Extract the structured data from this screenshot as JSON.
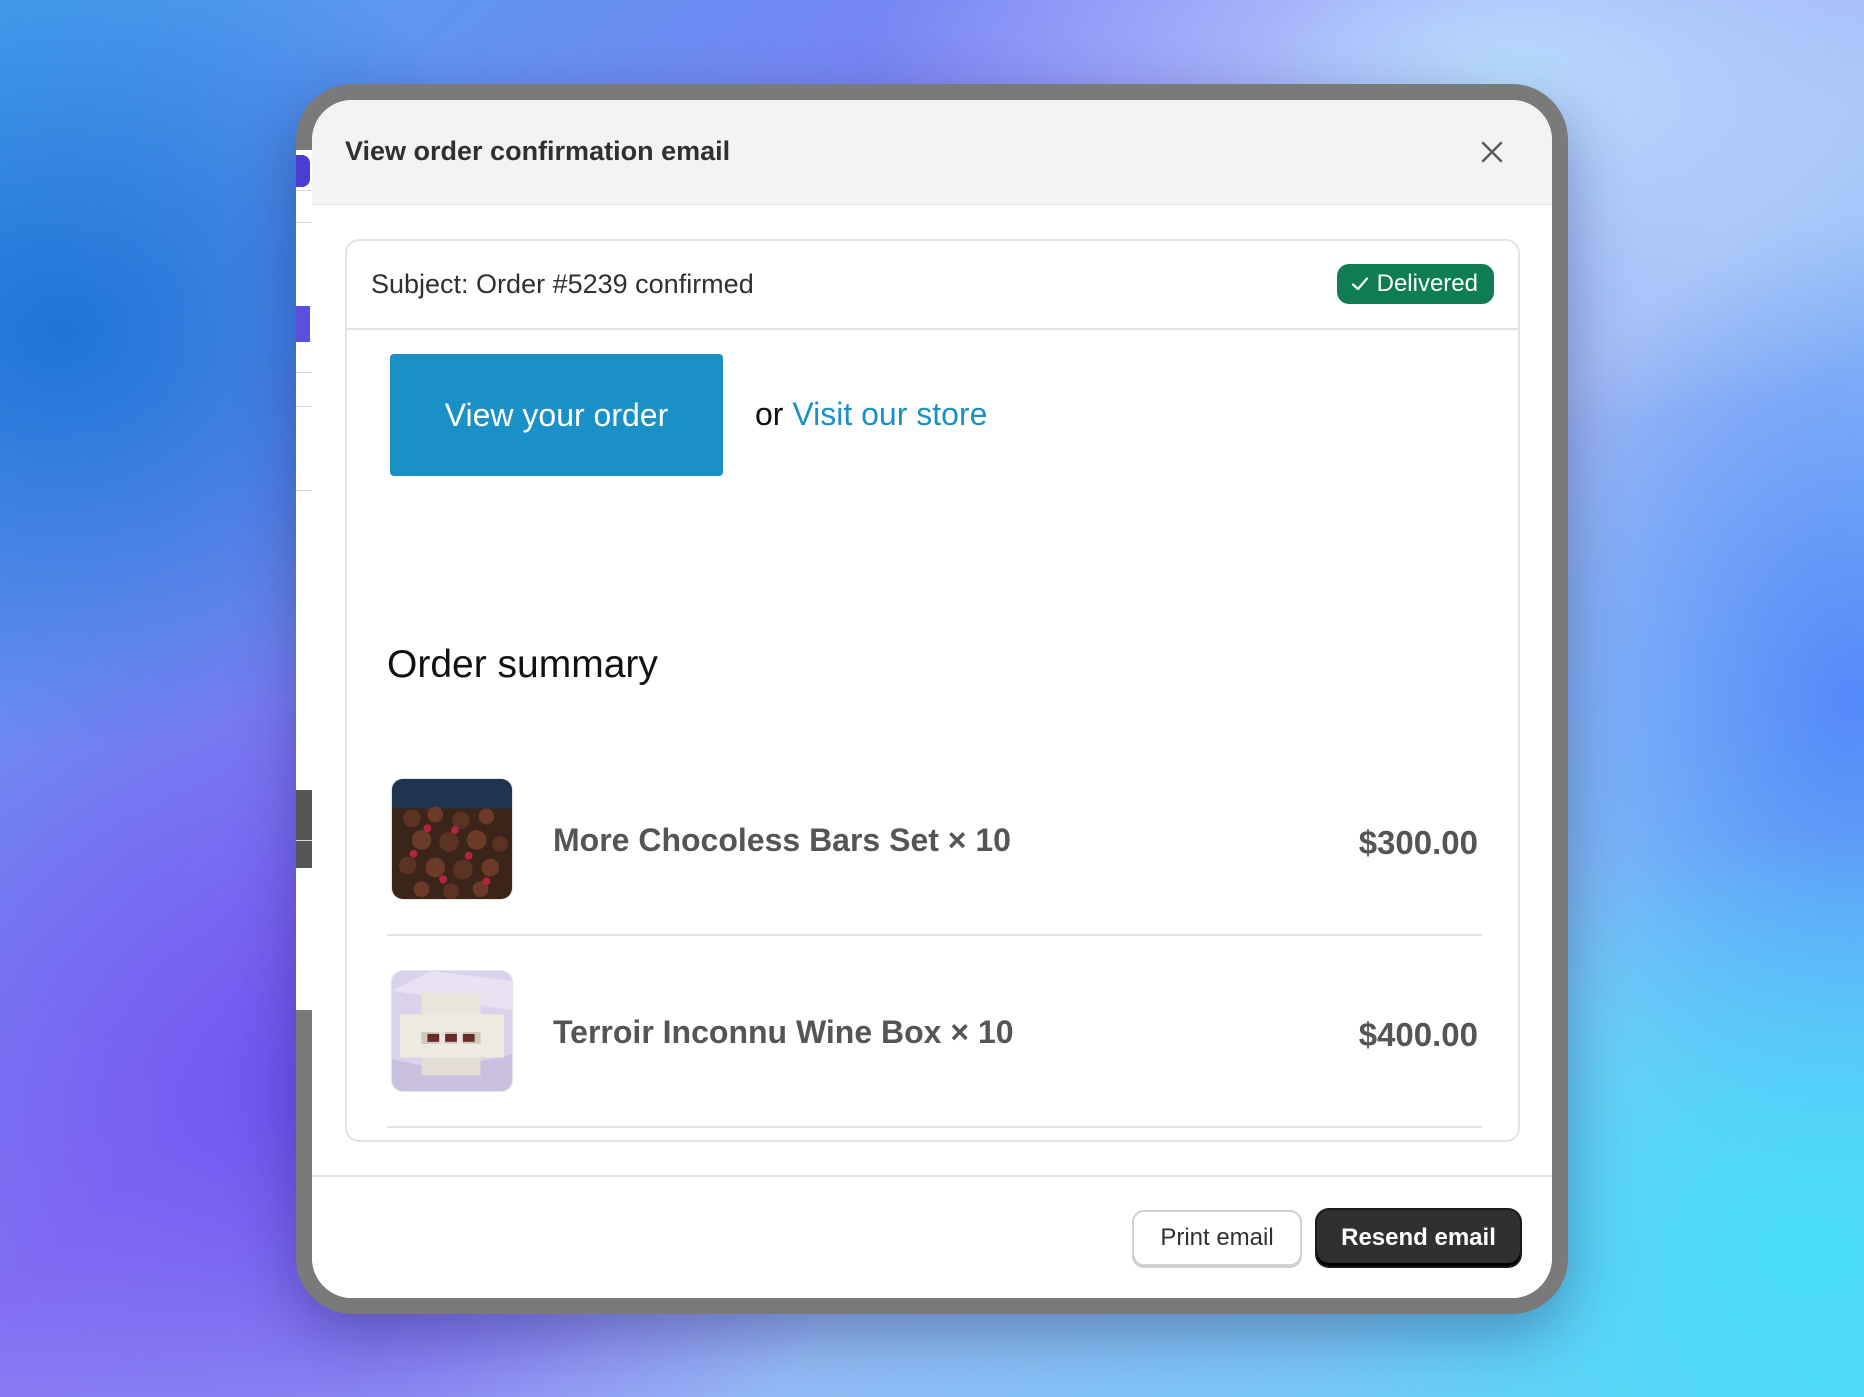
{
  "modal": {
    "title": "View order confirmation email",
    "close_icon": "close-icon"
  },
  "email": {
    "subject": "Subject: Order #5239 confirmed",
    "status_badge": "Delivered",
    "status_icon": "checkmark-icon",
    "status_color": "#0f7d53",
    "view_order_label": "View your order",
    "or_text": "or",
    "visit_store_label": "Visit our store",
    "accent_color": "#1a91c6"
  },
  "summary": {
    "title": "Order summary",
    "items": [
      {
        "name": "More Chocoless Bars Set × 10",
        "price": "$300.00",
        "thumbnail": "chocolate-truffles-image"
      },
      {
        "name": "Terroir Inconnu Wine Box × 10",
        "price": "$400.00",
        "thumbnail": "wine-box-image"
      }
    ]
  },
  "footer": {
    "print_label": "Print email",
    "resend_label": "Resend email"
  }
}
